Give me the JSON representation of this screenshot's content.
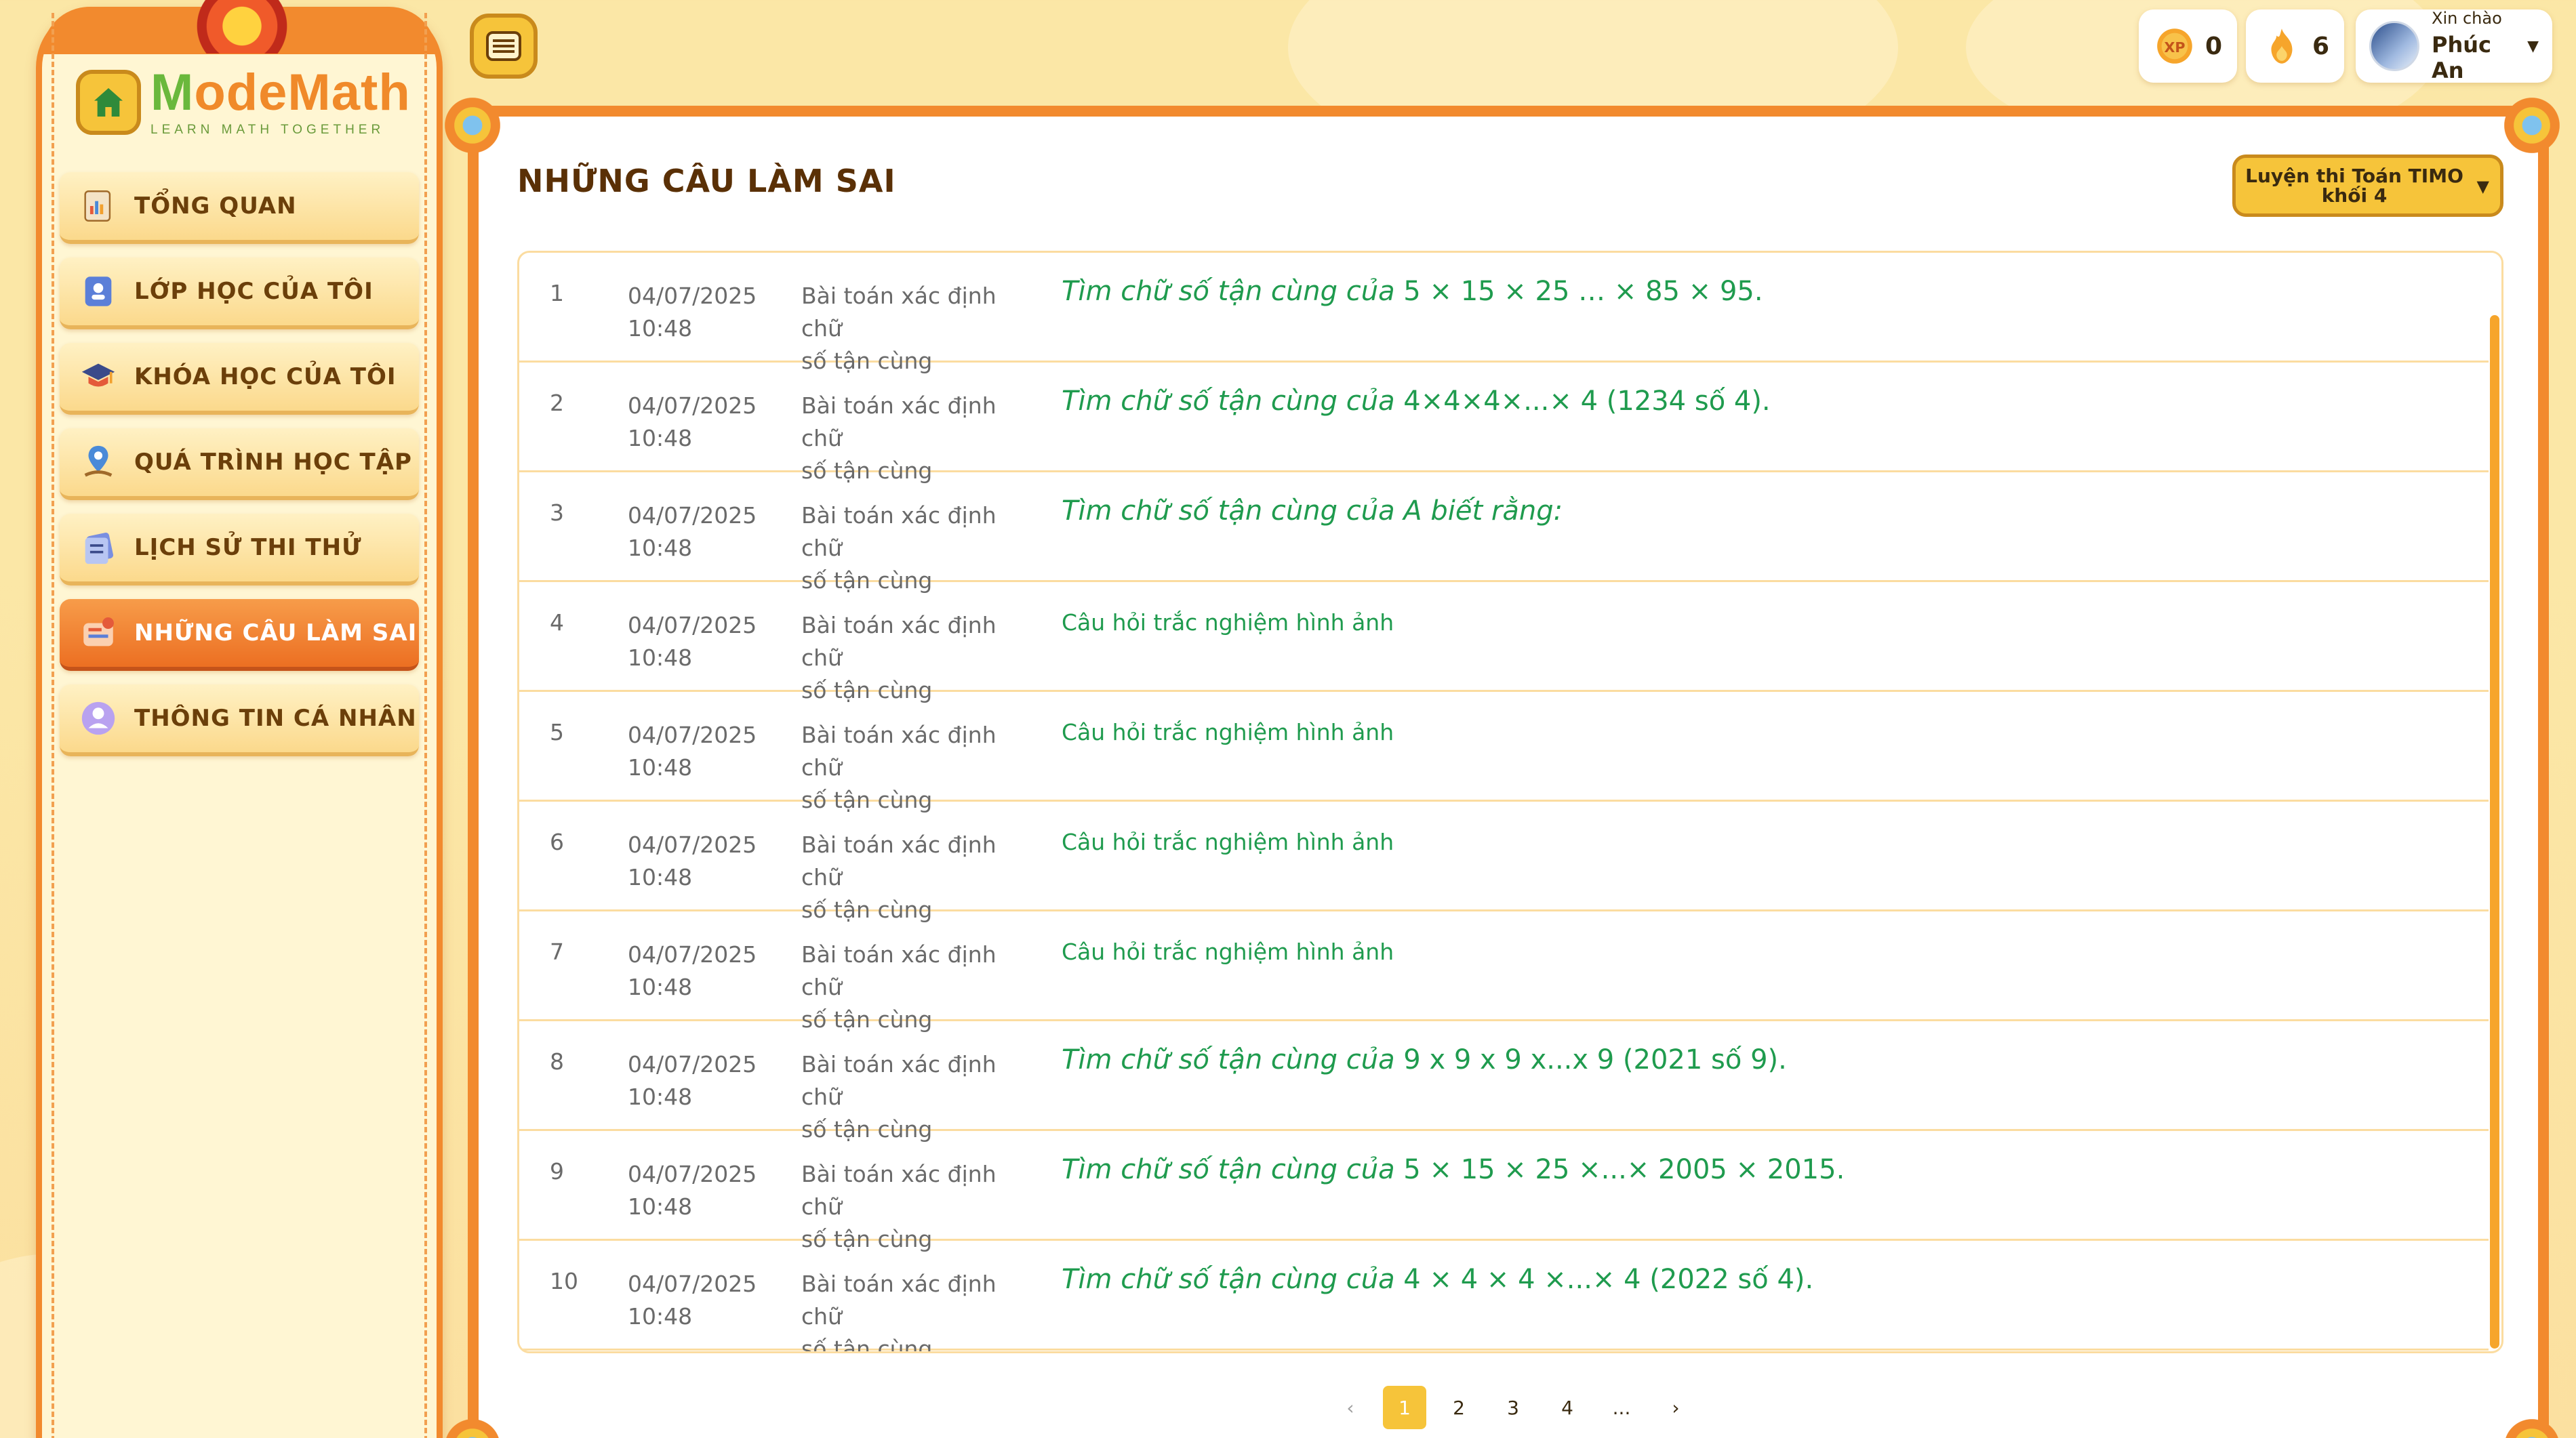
{
  "brand": {
    "logo_main_pre": "M",
    "logo_main_rest": "odeMath",
    "logo_tagline": "LEARN MATH TOGETHER"
  },
  "sidebar": {
    "items": [
      {
        "label": "TỔNG QUAN",
        "icon": "overview-icon",
        "active": false
      },
      {
        "label": "LỚP HỌC CỦA TÔI",
        "icon": "class-icon",
        "active": false
      },
      {
        "label": "KHÓA HỌC CỦA TÔI",
        "icon": "graduation-cap-icon",
        "active": false
      },
      {
        "label": "QUÁ TRÌNH HỌC TẬP",
        "icon": "progress-map-icon",
        "active": false
      },
      {
        "label": "LỊCH SỬ THI THỬ",
        "icon": "exam-history-icon",
        "active": false
      },
      {
        "label": "NHỮNG CÂU LÀM SAI",
        "icon": "wrong-answers-icon",
        "active": true
      },
      {
        "label": "THÔNG TIN CÁ NHÂN",
        "icon": "profile-icon",
        "active": false
      }
    ]
  },
  "topbar": {
    "xp": "0",
    "streak": "6",
    "greeting": "Xin chào",
    "user_name": "Phúc An"
  },
  "main": {
    "title": "NHỮNG CÂU LÀM SAI",
    "course_select": {
      "line1": "Luyện thi Toán TIMO",
      "line2": "khối 4"
    },
    "rows": [
      {
        "no": "1",
        "date": "04/07/2025",
        "time": "10:48",
        "topic1": "Bài toán xác định chữ",
        "topic2": "số tận cùng",
        "q_lead": "Tìm chữ số tận cùng của ",
        "q_rest": "5 × 15 × 25 … × 85 × 95.",
        "style": "italic"
      },
      {
        "no": "2",
        "date": "04/07/2025",
        "time": "10:48",
        "topic1": "Bài toán xác định chữ",
        "topic2": "số tận cùng",
        "q_lead": "Tìm chữ số tận cùng của ",
        "q_rest": "4×4×4×...× 4 (1234 số 4).",
        "style": "italic"
      },
      {
        "no": "3",
        "date": "04/07/2025",
        "time": "10:48",
        "topic1": "Bài toán xác định chữ",
        "topic2": "số tận cùng",
        "q_lead": "Tìm chữ số tận cùng của A biết rằng:",
        "q_rest": "",
        "style": "italic"
      },
      {
        "no": "4",
        "date": "04/07/2025",
        "time": "10:48",
        "topic1": "Bài toán xác định chữ",
        "topic2": "số tận cùng",
        "q_lead": "Câu hỏi trắc nghiệm hình ảnh",
        "q_rest": "",
        "style": "plain"
      },
      {
        "no": "5",
        "date": "04/07/2025",
        "time": "10:48",
        "topic1": "Bài toán xác định chữ",
        "topic2": "số tận cùng",
        "q_lead": "Câu hỏi trắc nghiệm hình ảnh",
        "q_rest": "",
        "style": "plain"
      },
      {
        "no": "6",
        "date": "04/07/2025",
        "time": "10:48",
        "topic1": "Bài toán xác định chữ",
        "topic2": "số tận cùng",
        "q_lead": "Câu hỏi trắc nghiệm hình ảnh",
        "q_rest": "",
        "style": "plain"
      },
      {
        "no": "7",
        "date": "04/07/2025",
        "time": "10:48",
        "topic1": "Bài toán xác định chữ",
        "topic2": "số tận cùng",
        "q_lead": "Câu hỏi trắc nghiệm hình ảnh",
        "q_rest": "",
        "style": "plain"
      },
      {
        "no": "8",
        "date": "04/07/2025",
        "time": "10:48",
        "topic1": "Bài toán xác định chữ",
        "topic2": "số tận cùng",
        "q_lead": "Tìm chữ số tận cùng của  ",
        "q_rest": "9 x 9 x 9 x...x 9 (2021 số 9).",
        "style": "italic"
      },
      {
        "no": "9",
        "date": "04/07/2025",
        "time": "10:48",
        "topic1": "Bài toán xác định chữ",
        "topic2": "số tận cùng",
        "q_lead": "Tìm chữ số tận cùng của ",
        "q_rest": "5 × 15 × 25 ×...× 2005 × 2015.",
        "style": "italic"
      },
      {
        "no": "10",
        "date": "04/07/2025",
        "time": "10:48",
        "topic1": "Bài toán xác định chữ",
        "topic2": "số tận cùng",
        "q_lead": "Tìm chữ số tận cùng của ",
        "q_rest": "4 × 4 × 4 ×...× 4 (2022 số 4).",
        "style": "italic"
      }
    ]
  },
  "pagination": {
    "prev": "‹",
    "pages": [
      "1",
      "2",
      "3",
      "4",
      "..."
    ],
    "active": "1",
    "next": "›"
  },
  "colors": {
    "accent": "#f28a2e",
    "sidebar_bg": "#fff6d3",
    "answer_text": "#1f9b4e",
    "active_item": "#ec6f22",
    "button_yellow": "#f6c43a"
  }
}
